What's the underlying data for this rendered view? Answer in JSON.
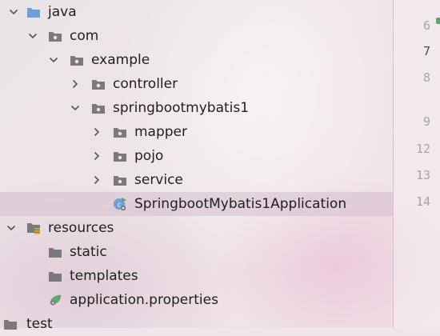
{
  "tree": {
    "items": [
      {
        "label": "java",
        "icon": "folder-blue-icon"
      },
      {
        "label": "com",
        "icon": "package-icon"
      },
      {
        "label": "example",
        "icon": "package-icon"
      },
      {
        "label": "controller",
        "icon": "package-icon"
      },
      {
        "label": "springbootmybatis1",
        "icon": "package-icon"
      },
      {
        "label": "mapper",
        "icon": "package-icon"
      },
      {
        "label": "pojo",
        "icon": "package-icon"
      },
      {
        "label": "service",
        "icon": "package-icon"
      },
      {
        "label": "SpringbootMybatis1Application",
        "icon": "spring-class-icon",
        "selected": true
      },
      {
        "label": "resources",
        "icon": "resources-folder-icon"
      },
      {
        "label": "static",
        "icon": "folder-gray-icon"
      },
      {
        "label": "templates",
        "icon": "folder-gray-icon"
      },
      {
        "label": "application.properties",
        "icon": "spring-properties-icon"
      },
      {
        "label": "test",
        "icon": "folder-gray-icon"
      }
    ]
  },
  "gutter": {
    "line_numbers": [
      "6",
      "7",
      "8",
      "9",
      "12",
      "13",
      "14"
    ],
    "current_line": "7"
  },
  "colors": {
    "blue_folder": "#6d9fd9",
    "gray_icon": "#7a7a7a",
    "spring_green": "#5aa86a",
    "selection": "#d6becd"
  }
}
